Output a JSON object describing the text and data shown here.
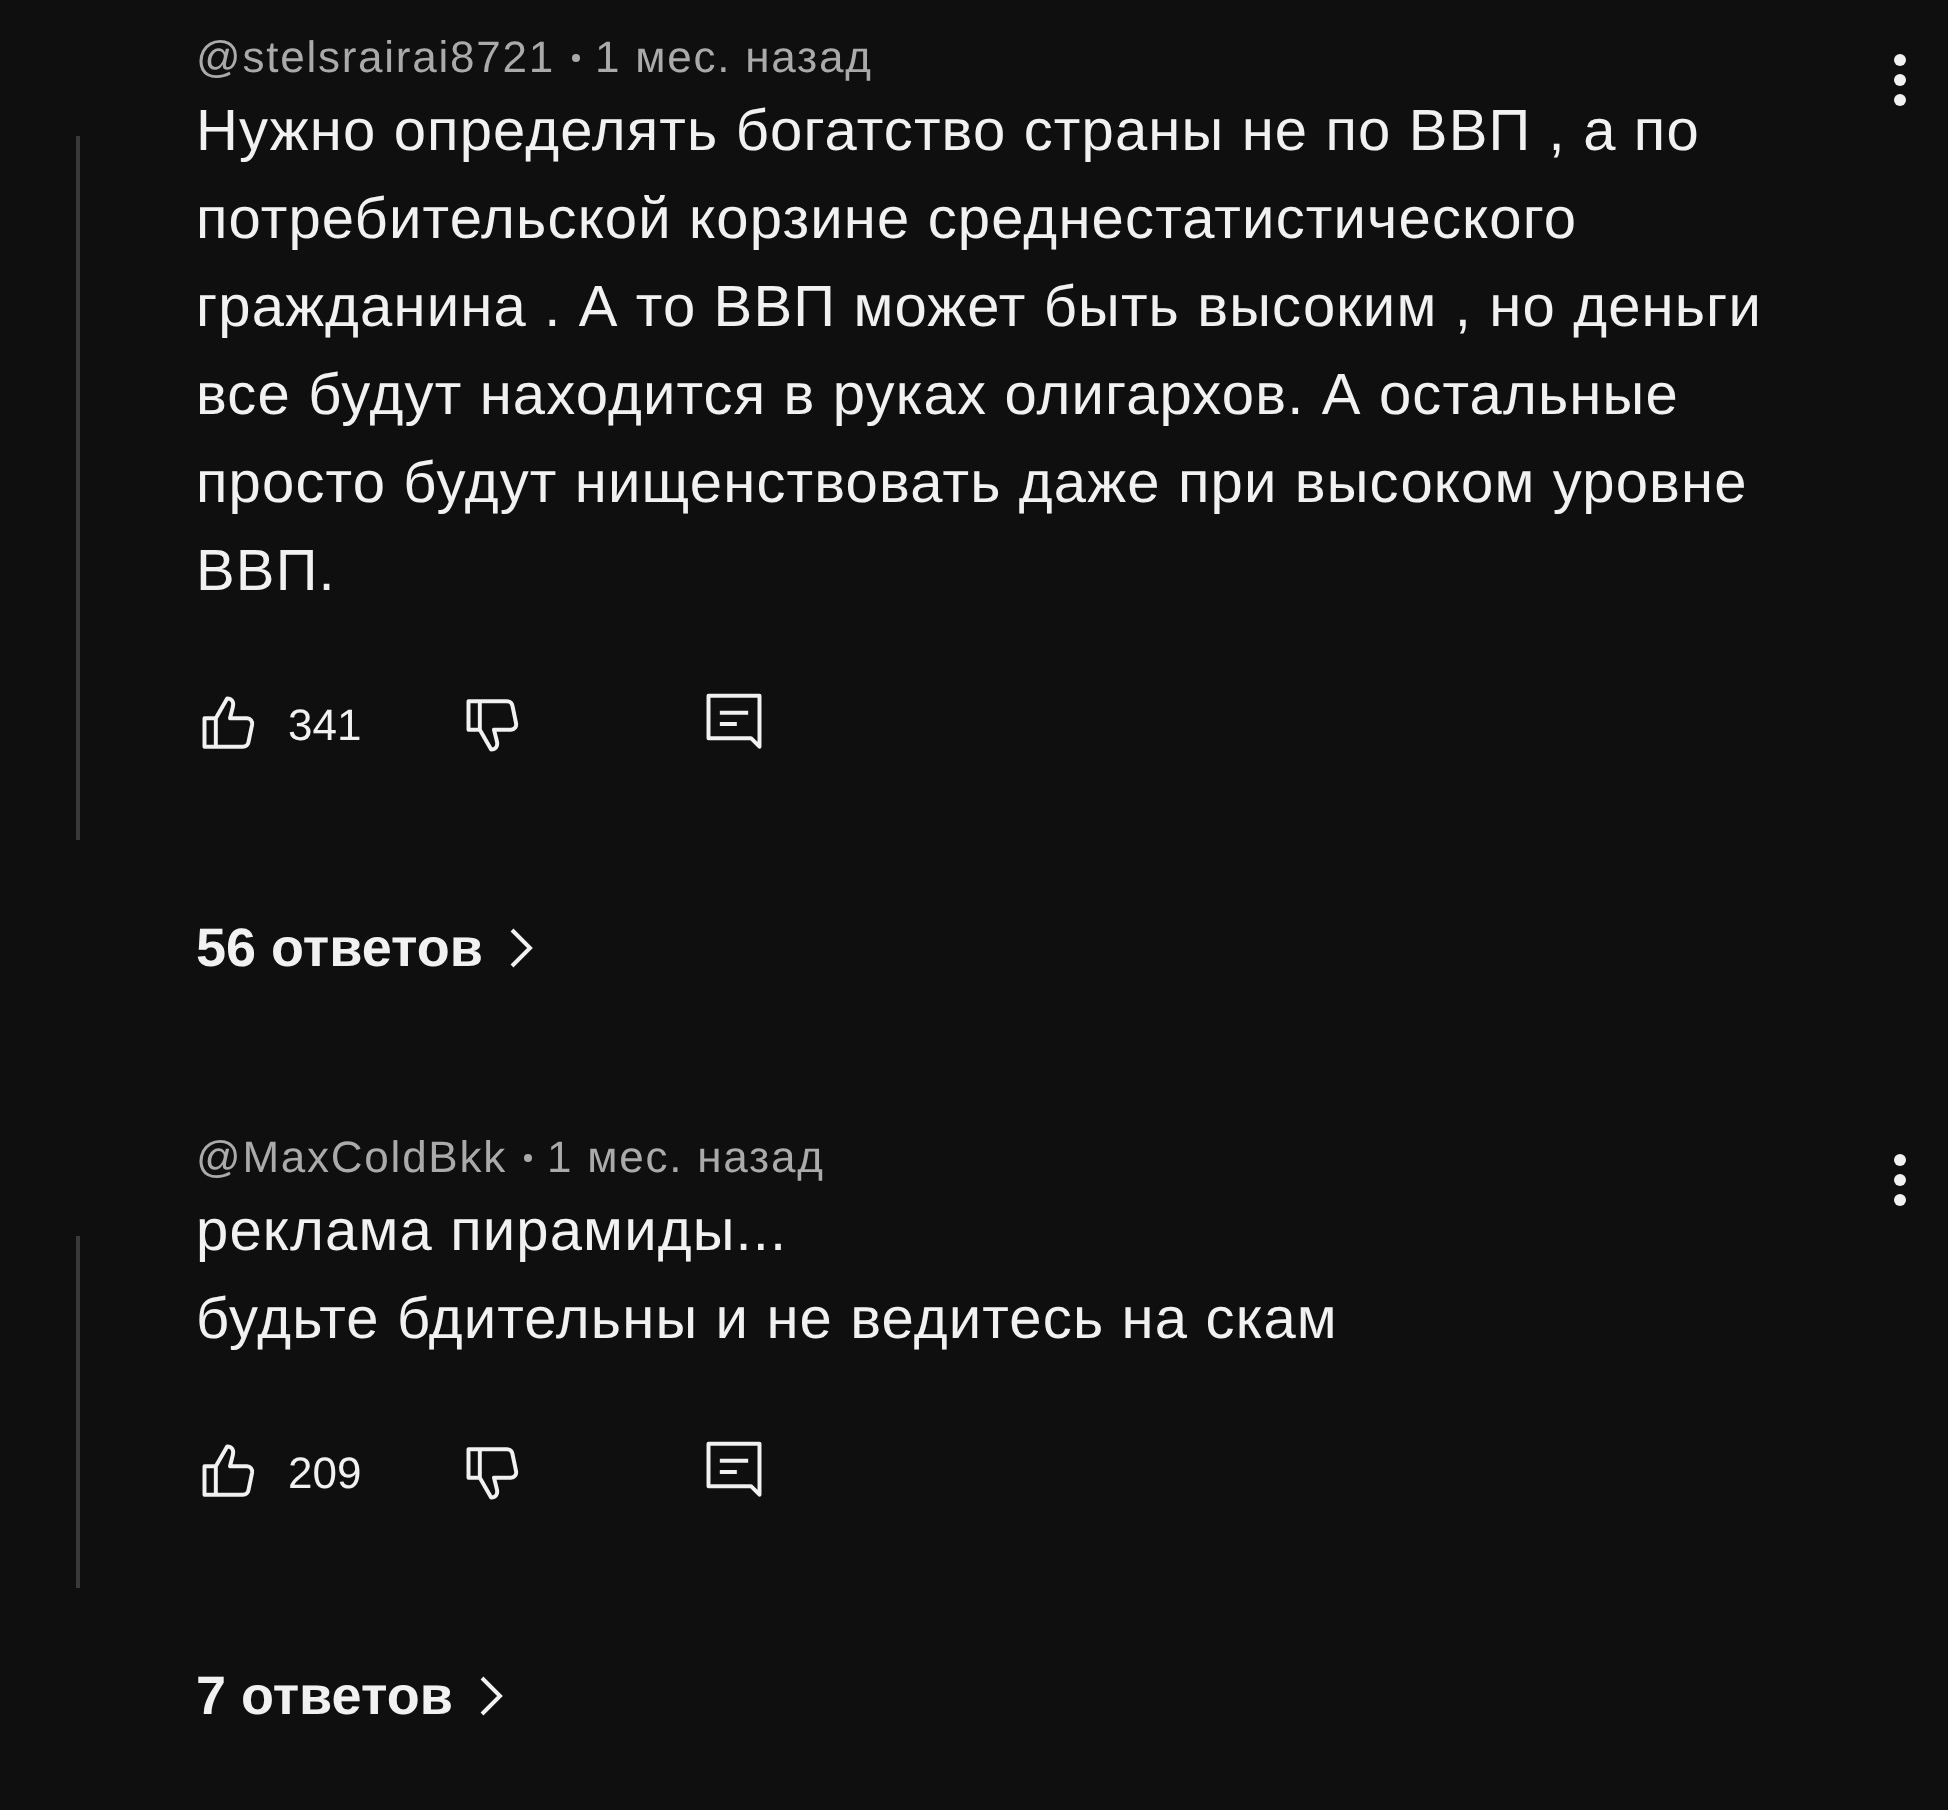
{
  "comments": [
    {
      "author": "@stelsrairai8721",
      "time": "1 мес. назад",
      "lines": [
        "Нужно определять богатство страны не по ВВП , а по",
        "потребительской корзине среднестатистического",
        "гражданина . А то ВВП может быть высоким , но деньги",
        "все будут находится в руках олигархов. А остальные",
        "просто будут нищенствовать даже при высоком уровне",
        "ВВП."
      ],
      "likes": "341",
      "replies": "56 ответов"
    },
    {
      "author": "@MaxColdBkk",
      "time": "1 мес. назад",
      "lines": [
        "реклама пирамиды...",
        "будьте бдительны и не ведитесь на скам"
      ],
      "likes": "209",
      "replies": "7 ответов"
    }
  ]
}
